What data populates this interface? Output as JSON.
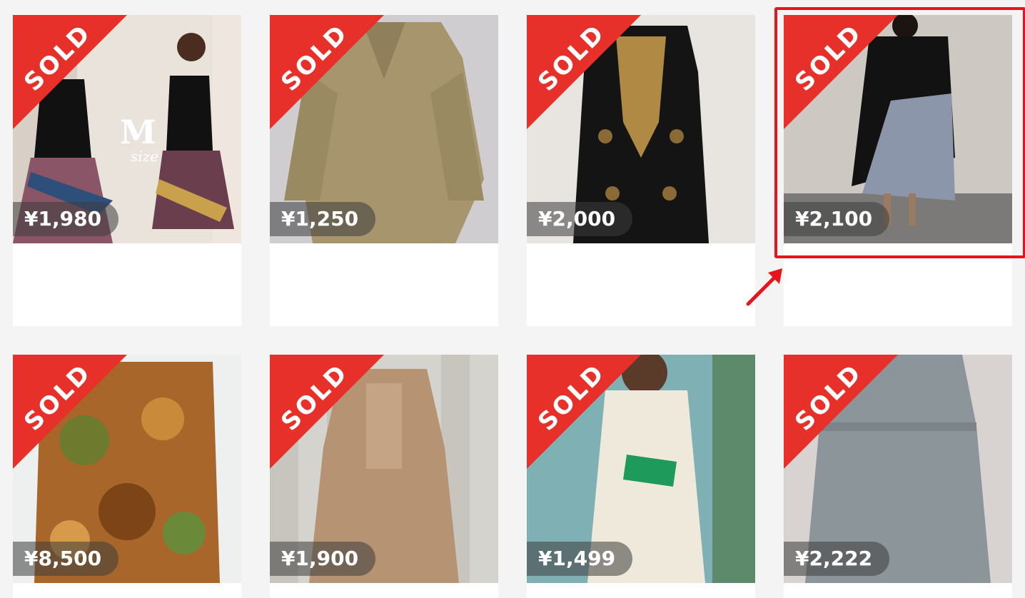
{
  "products": [
    {
      "badge": "SOLD",
      "price": "¥1,980",
      "image_text": "M",
      "image_subtext": "size"
    },
    {
      "badge": "SOLD",
      "price": "¥1,250"
    },
    {
      "badge": "SOLD",
      "price": "¥2,000"
    },
    {
      "badge": "SOLD",
      "price": "¥2,100"
    },
    {
      "badge": "SOLD",
      "price": "¥8,500"
    },
    {
      "badge": "SOLD",
      "price": "¥1,900"
    },
    {
      "badge": "SOLD",
      "price": "¥1,499"
    },
    {
      "badge": "SOLD",
      "price": "¥2,222"
    }
  ],
  "colors": {
    "sold_ribbon": "#e8302a",
    "highlight": "#e8141c",
    "page_bg": "#f4f4f4"
  },
  "annotation": {
    "highlighted_product": "¥2,100",
    "arrow_icon": "red-arrow-icon"
  }
}
